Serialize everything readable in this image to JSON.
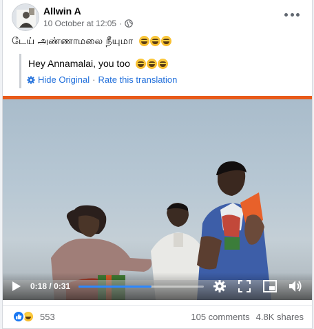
{
  "post": {
    "author": "Allwin A",
    "date": "10 October at 12:05",
    "meta_separator": "·",
    "original_text": "டேய் அண்ணாமலை நீயுமா",
    "original_emoji_count": 3,
    "icons": {
      "privacy": "globe-icon",
      "more": "more-options-icon"
    }
  },
  "translation": {
    "text": "Hey Annamalai, you too",
    "emoji_count": 3,
    "hide_label": "Hide Original",
    "separator": "·",
    "rate_label": "Rate this translation",
    "icon": "gear-icon"
  },
  "video": {
    "current_time": "0:18",
    "time_separator": "/",
    "duration": "0:31",
    "progress": 0.58,
    "accent_color": "#e85a1a",
    "progress_color": "#2d88ff",
    "icons": {
      "play": "play-icon",
      "settings": "gear-icon",
      "fullscreen": "fullscreen-icon",
      "pip": "picture-in-picture-icon",
      "volume": "volume-icon"
    }
  },
  "footer": {
    "reaction_count": "553",
    "comments": "105 comments",
    "shares": "4.8K shares",
    "reactions": [
      "like-icon",
      "haha-icon"
    ]
  },
  "colors": {
    "link": "#216fdb",
    "secondary_text": "#65676b",
    "like_blue": "#1877f2"
  }
}
